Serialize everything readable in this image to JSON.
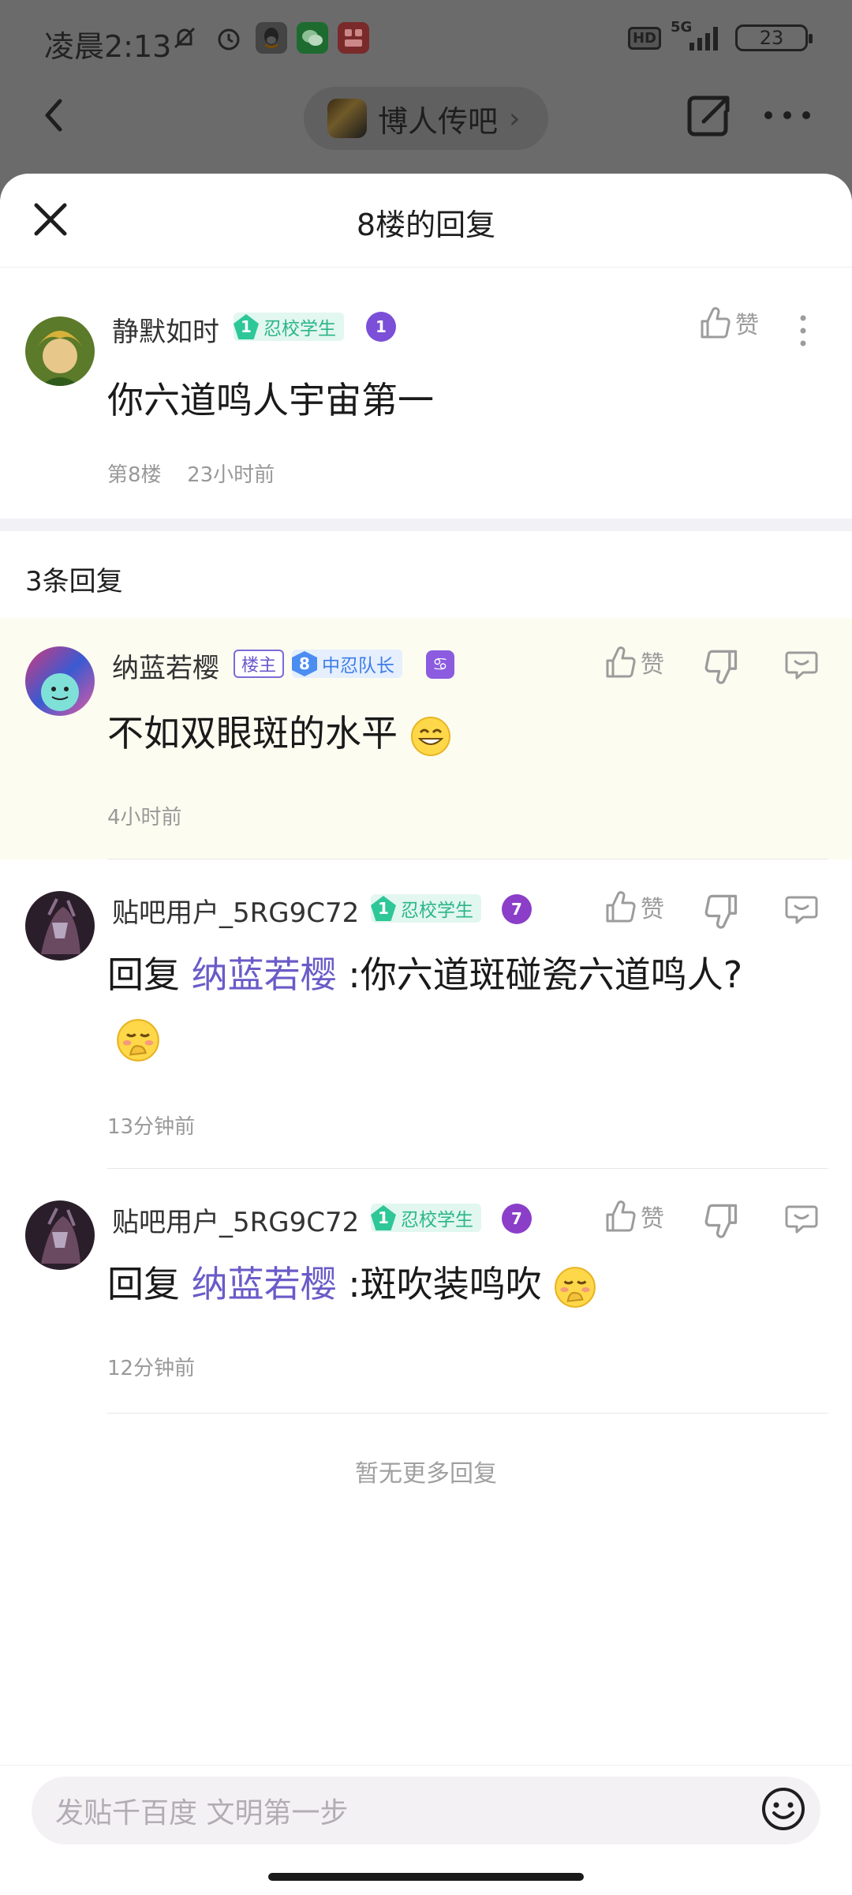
{
  "status_bar": {
    "time": "凌晨2:13",
    "icons": [
      "mute-icon",
      "alarm-icon",
      "qq-icon",
      "wechat-icon",
      "app-icon"
    ],
    "network": "5G",
    "hd": "HD",
    "battery": "23"
  },
  "nav": {
    "forum_name": "博人传吧",
    "chevron": "›"
  },
  "sheet": {
    "title": "8楼的回复",
    "op": {
      "username": "静默如时",
      "badge_level": "1",
      "badge_label": "忍校学生",
      "badge2": "1",
      "like_label": "赞",
      "content": "你六道鸣人宇宙第一",
      "floor": "第8楼",
      "time": "23小时前"
    },
    "reply_count": "3条回复",
    "replies": [
      {
        "username": "纳蓝若樱",
        "owner_tag": "楼主",
        "badge_level": "8",
        "badge_label": "中忍队长",
        "like_label": "赞",
        "content": "不如双眼斑的水平",
        "time": "4小时前"
      },
      {
        "username": "贴吧用户_5RG9C72",
        "badge_level": "1",
        "badge_label": "忍校学生",
        "badge2": "7",
        "like_label": "赞",
        "reply_prefix": "回复",
        "mention": "纳蓝若樱",
        "content_line1": ":你六道斑碰瓷六道鸣人?",
        "time": "13分钟前"
      },
      {
        "username": "贴吧用户_5RG9C72",
        "badge_level": "1",
        "badge_label": "忍校学生",
        "badge2": "7",
        "like_label": "赞",
        "reply_prefix": "回复",
        "mention": "纳蓝若樱",
        "content": ":斑吹装鸣吹",
        "time": "12分钟前"
      }
    ],
    "no_more": "暂无更多回复"
  },
  "input": {
    "placeholder": "发贴千百度 文明第一步"
  },
  "colors": {
    "accent_mention": "#6a5bc8",
    "badge_green": "#2ec797",
    "badge_blue": "#4b8df1",
    "highlight_bg": "#fdfcf1"
  }
}
